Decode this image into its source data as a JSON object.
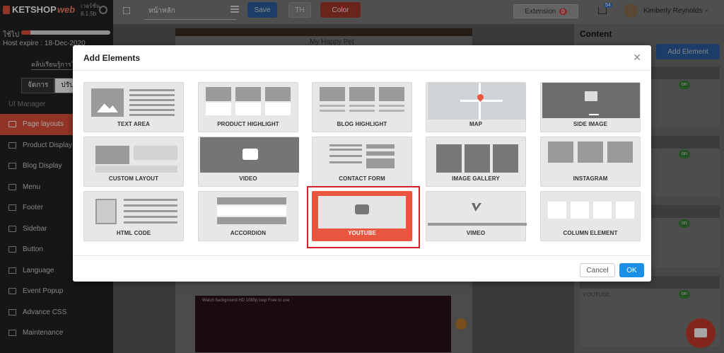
{
  "sidebar": {
    "logo_text": "KETSHOP",
    "logo_suffix": "web",
    "version": "เวอร์ชั่น 8.1.5b",
    "used_label": "ใช้ไป",
    "usage_fraction": 0.1,
    "host_expire": "Host expire : 18-Dec-2020",
    "manual_link": "คลิปเรียนรู้การใช้",
    "tab_manage": "จัดการ",
    "tab_adjust": "ปรับ",
    "section_label": "UI Manager",
    "menu": [
      {
        "label": "Page layouts",
        "icon": "page-layouts-icon",
        "active": true
      },
      {
        "label": "Product Display",
        "icon": "product-display-icon",
        "active": false
      },
      {
        "label": "Blog Display",
        "icon": "blog-display-icon",
        "active": false
      },
      {
        "label": "Menu",
        "icon": "menu-icon",
        "active": false
      },
      {
        "label": "Footer",
        "icon": "footer-icon",
        "active": false
      },
      {
        "label": "Sidebar",
        "icon": "sidebar-icon",
        "active": false
      },
      {
        "label": "Button",
        "icon": "toggle-icon",
        "active": false
      },
      {
        "label": "Language",
        "icon": "language-icon",
        "active": false
      },
      {
        "label": "Event Popup",
        "icon": "popup-icon",
        "active": false
      },
      {
        "label": "Advance CSS",
        "icon": "css-icon",
        "active": false
      },
      {
        "label": "Maintenance",
        "icon": "gear-icon",
        "active": false
      }
    ]
  },
  "topbar": {
    "page_select": "หน้าหลัก",
    "save_label": "Save",
    "lang_label": "TH",
    "color_label": "Color",
    "extension_label": "Extension",
    "extension_badge": "0",
    "cart_badge": "54",
    "user_name": "Kimberly Reynolds"
  },
  "right_panel": {
    "title": "Content",
    "add_element_label": "Add Element",
    "toggle_label": "on",
    "youtube_block_label": "YOUTUBE"
  },
  "canvas": {
    "logo_text": "My Happy Pet",
    "video_title": "Watch background HD 1080p loop Free to use"
  },
  "modal": {
    "title": "Add Elements",
    "cancel_label": "Cancel",
    "ok_label": "OK",
    "selected": "YOUTUBE",
    "elements": [
      {
        "label": "TEXT AREA"
      },
      {
        "label": "PRODUCT HIGHLIGHT"
      },
      {
        "label": "BLOG HIGHLIGHT"
      },
      {
        "label": "MAP"
      },
      {
        "label": "SIDE IMAGE"
      },
      {
        "label": "CUSTOM LAYOUT"
      },
      {
        "label": "VIDEO"
      },
      {
        "label": "CONTACT FORM"
      },
      {
        "label": "IMAGE GALLERY"
      },
      {
        "label": "INSTAGRAM"
      },
      {
        "label": "HTML CODE"
      },
      {
        "label": "ACCORDION"
      },
      {
        "label": "YOUTUBE"
      },
      {
        "label": "VIMEO"
      },
      {
        "label": "COLUMN ELEMENT"
      }
    ]
  },
  "colors": {
    "accent": "#e9553f",
    "primary": "#1a8fe6",
    "selected_border": "#d3232a"
  }
}
